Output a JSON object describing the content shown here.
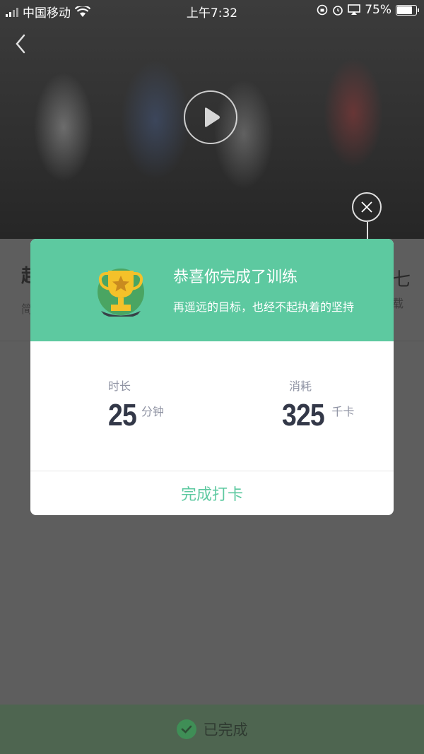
{
  "status_bar": {
    "carrier": "中国移动",
    "time": "上午7:32",
    "battery": "75%",
    "battery_level": 0.75
  },
  "background": {
    "title_left": "起",
    "subtitle_left": "简",
    "title_right": "七",
    "subtitle_right": "载"
  },
  "modal": {
    "title": "恭喜你完成了训练",
    "subtitle": "再遥远的目标，也经不起执着的坚持",
    "stats": [
      {
        "label": "时长",
        "value": "25",
        "unit": "分钟"
      },
      {
        "label": "消耗",
        "value": "325",
        "unit": "千卡"
      }
    ],
    "checkin_button": "完成打卡"
  },
  "bottom_bar": {
    "label": "已完成"
  },
  "colors": {
    "accent": "#5dc9a0",
    "trophy_gold": "#f4c12a",
    "trophy_circle": "#4aa562"
  },
  "icons": [
    "back-icon",
    "play-icon",
    "close-icon",
    "trophy-icon",
    "check-circle-icon",
    "wifi-icon",
    "battery-icon"
  ]
}
